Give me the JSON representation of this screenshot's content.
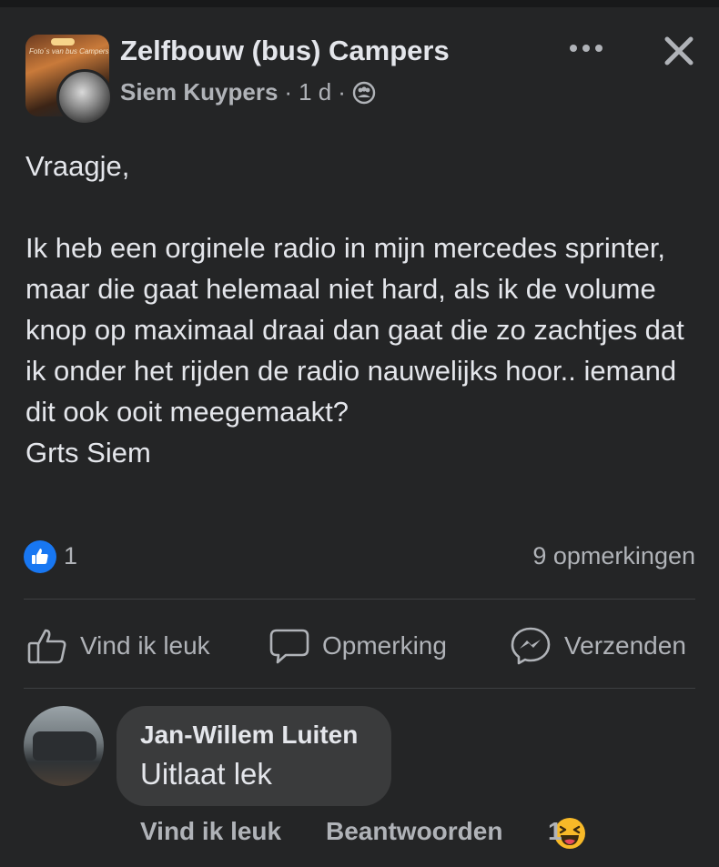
{
  "post": {
    "group_name": "Zelfbouw (bus) Campers",
    "group_avatar_text": "Foto´s van bus Campers Cam...",
    "author": "Siem Kuypers",
    "time": "1 d",
    "separator": "·",
    "privacy_icon": "group-members-icon",
    "body": "Vraagje,\n\nIk heb een orginele radio in mijn mercedes sprinter, maar die gaat helemaal niet hard, als ik de volume knop op maximaal draai dan gaat die zo zachtjes dat ik onder het rijden de radio nauwelijks hoor.. iemand dit ook ooit meegemaakt?\nGrts Siem",
    "reactions_count": "1",
    "comments_count": "9 opmerkingen"
  },
  "actions": {
    "like": "Vind ik leuk",
    "comment": "Opmerking",
    "send": "Verzenden"
  },
  "comment": {
    "author": "Jan-Willem Luiten",
    "text": "Uitlaat lek",
    "like": "Vind ik leuk",
    "reply": "Beantwoorden",
    "reaction_count": "1",
    "reaction_icon": "haha-emoji-icon"
  },
  "colors": {
    "background": "#242526",
    "bubble": "#3a3b3c",
    "text_primary": "#e4e6eb",
    "text_secondary": "#b0b3b8",
    "like_blue": "#1877f2",
    "haha_yellow": "#f7b928"
  }
}
